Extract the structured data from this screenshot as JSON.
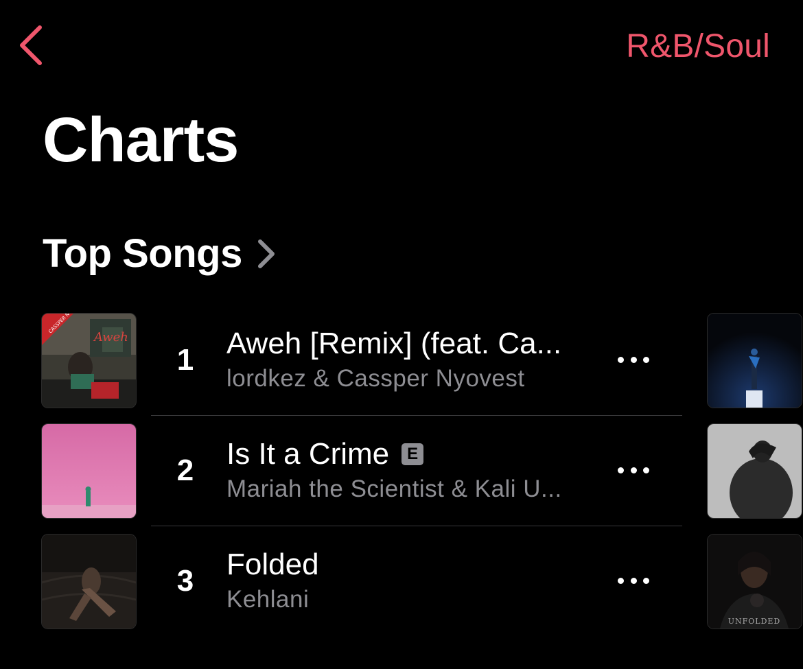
{
  "nav": {
    "genre": "R&B/Soul"
  },
  "page": {
    "title": "Charts"
  },
  "section": {
    "title": "Top Songs"
  },
  "songs": [
    {
      "rank": "1",
      "title": "Aweh [Remix] (feat. Ca...",
      "artist": "lordkez & Cassper Nyovest",
      "explicit": false,
      "art_text": "CASSPER NYOVEST"
    },
    {
      "rank": "2",
      "title": "Is It a Crime",
      "artist": "Mariah the Scientist & Kali U...",
      "explicit": true,
      "explicit_label": "E"
    },
    {
      "rank": "3",
      "title": "Folded",
      "artist": "Kehlani",
      "explicit": false
    }
  ],
  "next_column": {
    "art_text_3": "UNFOLDED"
  },
  "colors": {
    "accent": "#f0566c",
    "secondary_text": "#8e8e93",
    "background": "#000000"
  }
}
